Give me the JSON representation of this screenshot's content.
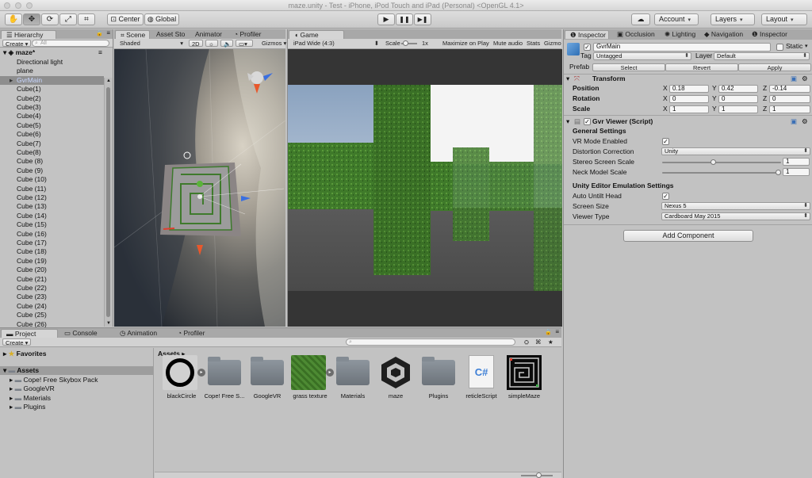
{
  "window": {
    "title": "maze.unity - Test - iPhone, iPod Touch and iPad (Personal) <OpenGL 4.1>"
  },
  "toolbar": {
    "tools": [
      "hand-tool",
      "move-tool",
      "rotate-tool",
      "scale-tool",
      "rect-tool"
    ],
    "pivot_label": "Center",
    "space_label": "Global",
    "play_symbol": "▶",
    "pause_symbol": "❚❚",
    "step_symbol": "▶❚",
    "account_label": "Account",
    "layers_label": "Layers",
    "layout_label": "Layout",
    "cloud_symbol": "☁"
  },
  "hierarchy": {
    "tab_label": "Hierarchy",
    "create_label": "Create",
    "search_placeholder": "All",
    "scene_name": "maze*",
    "items": [
      "Directional light",
      "plane",
      "GvrMain",
      "Cube(1)",
      "Cube(2)",
      "Cube(3)",
      "Cube(4)",
      "Cube(5)",
      "Cube(6)",
      "Cube(7)",
      "Cube(8)",
      "Cube (8)",
      "Cube (9)",
      "Cube (10)",
      "Cube (11)",
      "Cube (12)",
      "Cube (13)",
      "Cube (14)",
      "Cube (15)",
      "Cube (16)",
      "Cube (17)",
      "Cube (18)",
      "Cube (19)",
      "Cube (20)",
      "Cube (21)",
      "Cube (22)",
      "Cube (23)",
      "Cube (24)",
      "Cube (25)",
      "Cube (26)"
    ],
    "selected_index": 2
  },
  "scene": {
    "tabs": [
      "Scene",
      "Asset Sto",
      "Animator",
      "Profiler"
    ],
    "shading_label": "Shaded",
    "mode_2d_label": "2D",
    "gizmos_label": "Gizmos"
  },
  "game": {
    "tab_label": "Game",
    "aspect_label": "iPad Wide (4:3)",
    "scale_label": "Scale",
    "scale_value": "1x",
    "maximize_label": "Maximize on Play",
    "mute_label": "Mute audio",
    "stats_label": "Stats",
    "gizmos_label": "Gizmo"
  },
  "inspector": {
    "tabs": [
      "Inspector",
      "Occlusion",
      "Lighting",
      "Navigation",
      "Inspector"
    ],
    "object_name": "GvrMain",
    "static_label": "Static",
    "tag_label": "Tag",
    "tag_value": "Untagged",
    "layer_label": "Layer",
    "layer_value": "Default",
    "prefab_label": "Prefab",
    "prefab_select": "Select",
    "prefab_revert": "Revert",
    "prefab_apply": "Apply",
    "transform": {
      "title": "Transform",
      "position_label": "Position",
      "rotation_label": "Rotation",
      "scale_label": "Scale",
      "x": "X",
      "y": "Y",
      "z": "Z",
      "position": [
        "0.18",
        "0.42",
        "-0.14"
      ],
      "rotation": [
        "0",
        "0",
        "0"
      ],
      "scale": [
        "1",
        "1",
        "1"
      ]
    },
    "gvr": {
      "title": "Gvr Viewer (Script)",
      "general_header": "General Settings",
      "vr_mode_label": "VR Mode Enabled",
      "distortion_label": "Distortion Correction",
      "distortion_value": "Unity",
      "stereo_label": "Stereo Screen Scale",
      "stereo_value": "1",
      "stereo_fraction": 0.5,
      "neck_label": "Neck Model Scale",
      "neck_value": "1",
      "neck_fraction": 1.0,
      "emulation_header": "Unity Editor Emulation Settings",
      "auto_untilt_label": "Auto Untilt Head",
      "screen_size_label": "Screen Size",
      "screen_size_value": "Nexus 5",
      "viewer_type_label": "Viewer Type",
      "viewer_type_value": "Cardboard May 2015"
    },
    "add_component_label": "Add Component"
  },
  "bottom_tabs": [
    "Project",
    "Console",
    "Animation",
    "Profiler"
  ],
  "project": {
    "create_label": "Create",
    "favorites_label": "Favorites",
    "assets_label": "Assets",
    "tree": [
      "Cope! Free Skybox Pack",
      "GoogleVR",
      "Materials",
      "Plugins"
    ],
    "breadcrumb": "Assets",
    "assets": [
      {
        "name": "blackCircle",
        "kind": "circle"
      },
      {
        "name": "Cope! Free S...",
        "kind": "folder"
      },
      {
        "name": "GoogleVR",
        "kind": "folder"
      },
      {
        "name": "grass texture",
        "kind": "grass"
      },
      {
        "name": "Materials",
        "kind": "folder"
      },
      {
        "name": "maze",
        "kind": "unity"
      },
      {
        "name": "Plugins",
        "kind": "folder"
      },
      {
        "name": "reticleScript",
        "kind": "script"
      },
      {
        "name": "simpleMaze",
        "kind": "maze"
      }
    ]
  }
}
